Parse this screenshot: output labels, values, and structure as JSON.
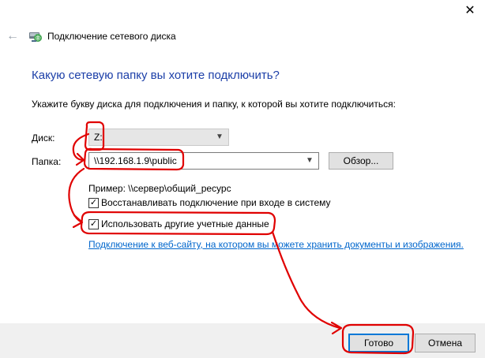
{
  "window": {
    "close_glyph": "✕",
    "back_glyph": "←",
    "title": "Подключение сетевого диска"
  },
  "content": {
    "heading": "Какую сетевую папку вы хотите подключить?",
    "instruction": "Укажите букву диска для подключения и папку, к которой вы хотите подключиться:",
    "drive_label": "Диск:",
    "drive_value": "Z:",
    "folder_label": "Папка:",
    "folder_value": "\\\\192.168.1.9\\public",
    "browse_label": "Обзор...",
    "example": "Пример: \\\\сервер\\общий_ресурс",
    "reconnect_label": "Восстанавливать подключение при входе в систему",
    "reconnect_checked": true,
    "credentials_label": "Использовать другие учетные данные",
    "credentials_checked": true,
    "website_link": "Подключение к веб-сайту, на котором вы можете хранить документы и изображения."
  },
  "footer": {
    "done_label": "Готово",
    "cancel_label": "Отмена"
  },
  "colors": {
    "heading": "#1c3fa8",
    "link": "#0066cc",
    "annotation": "#e00000",
    "focus": "#0078d7"
  },
  "icons": {
    "back": "back-arrow-icon",
    "dialog": "network-drive-icon",
    "close": "close-icon",
    "dropdown": "chevron-down-icon",
    "check": "checkmark-icon"
  }
}
